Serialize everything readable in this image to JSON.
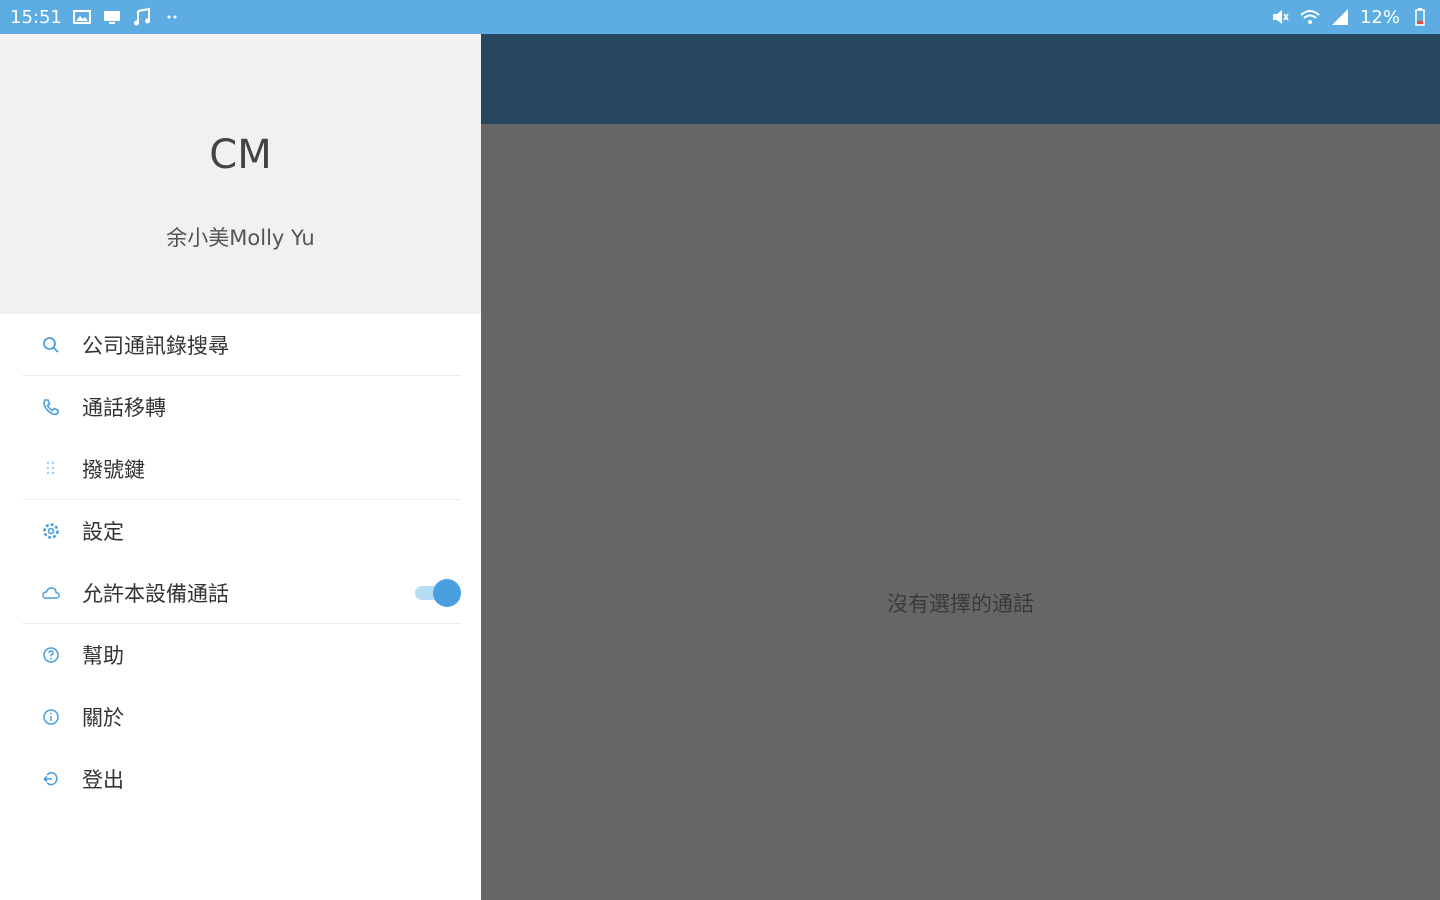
{
  "status_bar": {
    "time": "15:51",
    "battery": "12%",
    "left_icons": [
      "image-icon",
      "cast-icon",
      "music-icon",
      "more-dots-icon"
    ],
    "right_icons": [
      "mute-icon",
      "wifi-icon",
      "signal-icon",
      "battery-icon"
    ]
  },
  "drawer": {
    "initials": "CM",
    "user_name": "余小美Molly Yu",
    "items": [
      {
        "label": "公司通訊錄搜尋",
        "icon": "search-icon"
      },
      {
        "label": "通話移轉",
        "icon": "phone-icon"
      },
      {
        "label": "撥號鍵",
        "icon": "dialpad-icon"
      },
      {
        "label": "設定",
        "icon": "gear-icon"
      },
      {
        "label": "允許本設備通話",
        "icon": "cloud-icon",
        "toggle": "on"
      },
      {
        "label": "幫助",
        "icon": "help-icon"
      },
      {
        "label": "關於",
        "icon": "info-icon"
      },
      {
        "label": "登出",
        "icon": "logout-icon"
      }
    ]
  },
  "main": {
    "empty_message": "沒有選擇的通話"
  },
  "colors": {
    "status_bar": "#5dade2",
    "app_bar": "#274760",
    "content_bg": "#666666",
    "accent": "#4a9fe0"
  }
}
